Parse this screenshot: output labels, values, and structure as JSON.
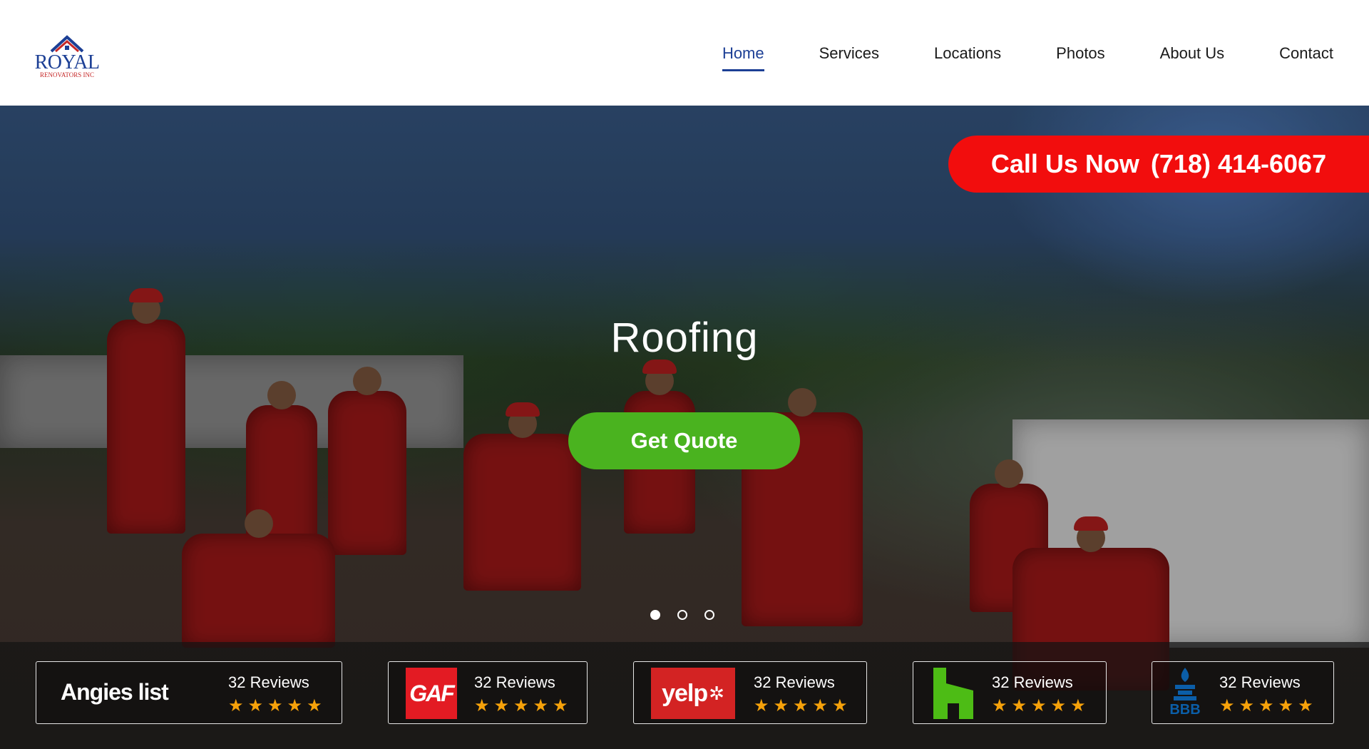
{
  "brand": {
    "name": "ROYAL",
    "subtitle": "RENOVATORS INC",
    "colors": {
      "primary": "#1c3f95",
      "accent": "#c62828"
    }
  },
  "nav": {
    "items": [
      {
        "label": "Home",
        "active": true
      },
      {
        "label": "Services",
        "active": false
      },
      {
        "label": "Locations",
        "active": false
      },
      {
        "label": "Photos",
        "active": false
      },
      {
        "label": "About Us",
        "active": false
      },
      {
        "label": "Contact",
        "active": false
      }
    ]
  },
  "hero": {
    "title": "Roofing",
    "cta_label": "Get Quote",
    "call": {
      "label": "Call Us Now",
      "phone": "(718) 414-6067"
    },
    "slides": {
      "count": 3,
      "active_index": 0
    },
    "colors": {
      "cta": "#4ab31f",
      "call": "#f20d0d"
    }
  },
  "reviews": [
    {
      "source": "Angie's list",
      "logo_text": "Angies list",
      "count_label": "32 Reviews",
      "stars": "★★★★★",
      "rating": 5
    },
    {
      "source": "GAF",
      "logo_text": "GAF",
      "count_label": "32 Reviews",
      "stars": "★★★★★",
      "rating": 5
    },
    {
      "source": "Yelp",
      "logo_text": "yelp",
      "count_label": "32 Reviews",
      "stars": "★★★★★",
      "rating": 5
    },
    {
      "source": "Houzz",
      "logo_text": "",
      "count_label": "32 Reviews",
      "stars": "★★★★★",
      "rating": 5
    },
    {
      "source": "BBB",
      "logo_text": "BBB",
      "count_label": "32 Reviews",
      "stars": "★★★★★",
      "rating": 5
    }
  ],
  "icons": {
    "logo": "house-roof-icon",
    "angies": "angies-list-logo-icon",
    "gaf": "gaf-logo-icon",
    "yelp": "yelp-logo-icon",
    "houzz": "houzz-logo-icon",
    "bbb": "bbb-logo-icon",
    "star": "star-icon"
  }
}
